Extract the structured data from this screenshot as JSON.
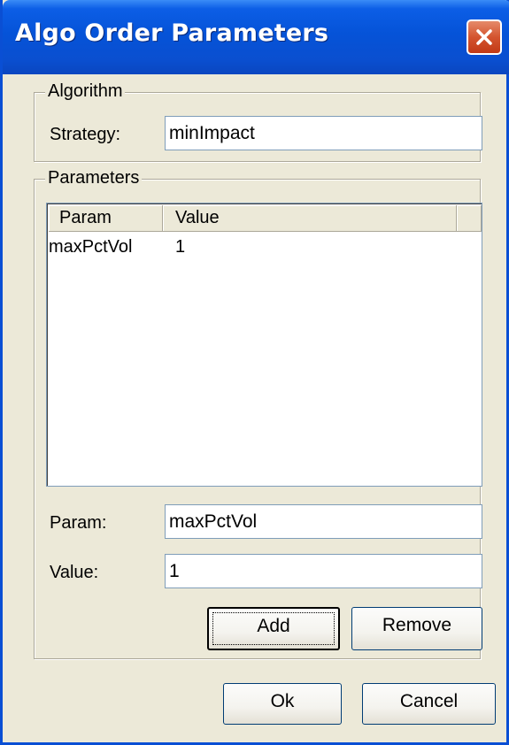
{
  "window": {
    "title": "Algo Order Parameters",
    "close_icon": "close-x-icon"
  },
  "algorithm_group": {
    "label": "Algorithm",
    "strategy_label": "Strategy:",
    "strategy_value": "minImpact"
  },
  "parameters_group": {
    "label": "Parameters",
    "columns": [
      "Param",
      "Value"
    ],
    "rows": [
      {
        "param": "maxPctVol",
        "value": "1"
      }
    ],
    "param_label": "Param:",
    "param_value": "maxPctVol",
    "value_label": "Value:",
    "value_value": "1",
    "add_label": "Add",
    "remove_label": "Remove"
  },
  "footer": {
    "ok_label": "Ok",
    "cancel_label": "Cancel"
  },
  "colors": {
    "titlebar": "#0553d8",
    "close_button": "#d4542f",
    "dialog_bg": "#ece9d8"
  }
}
